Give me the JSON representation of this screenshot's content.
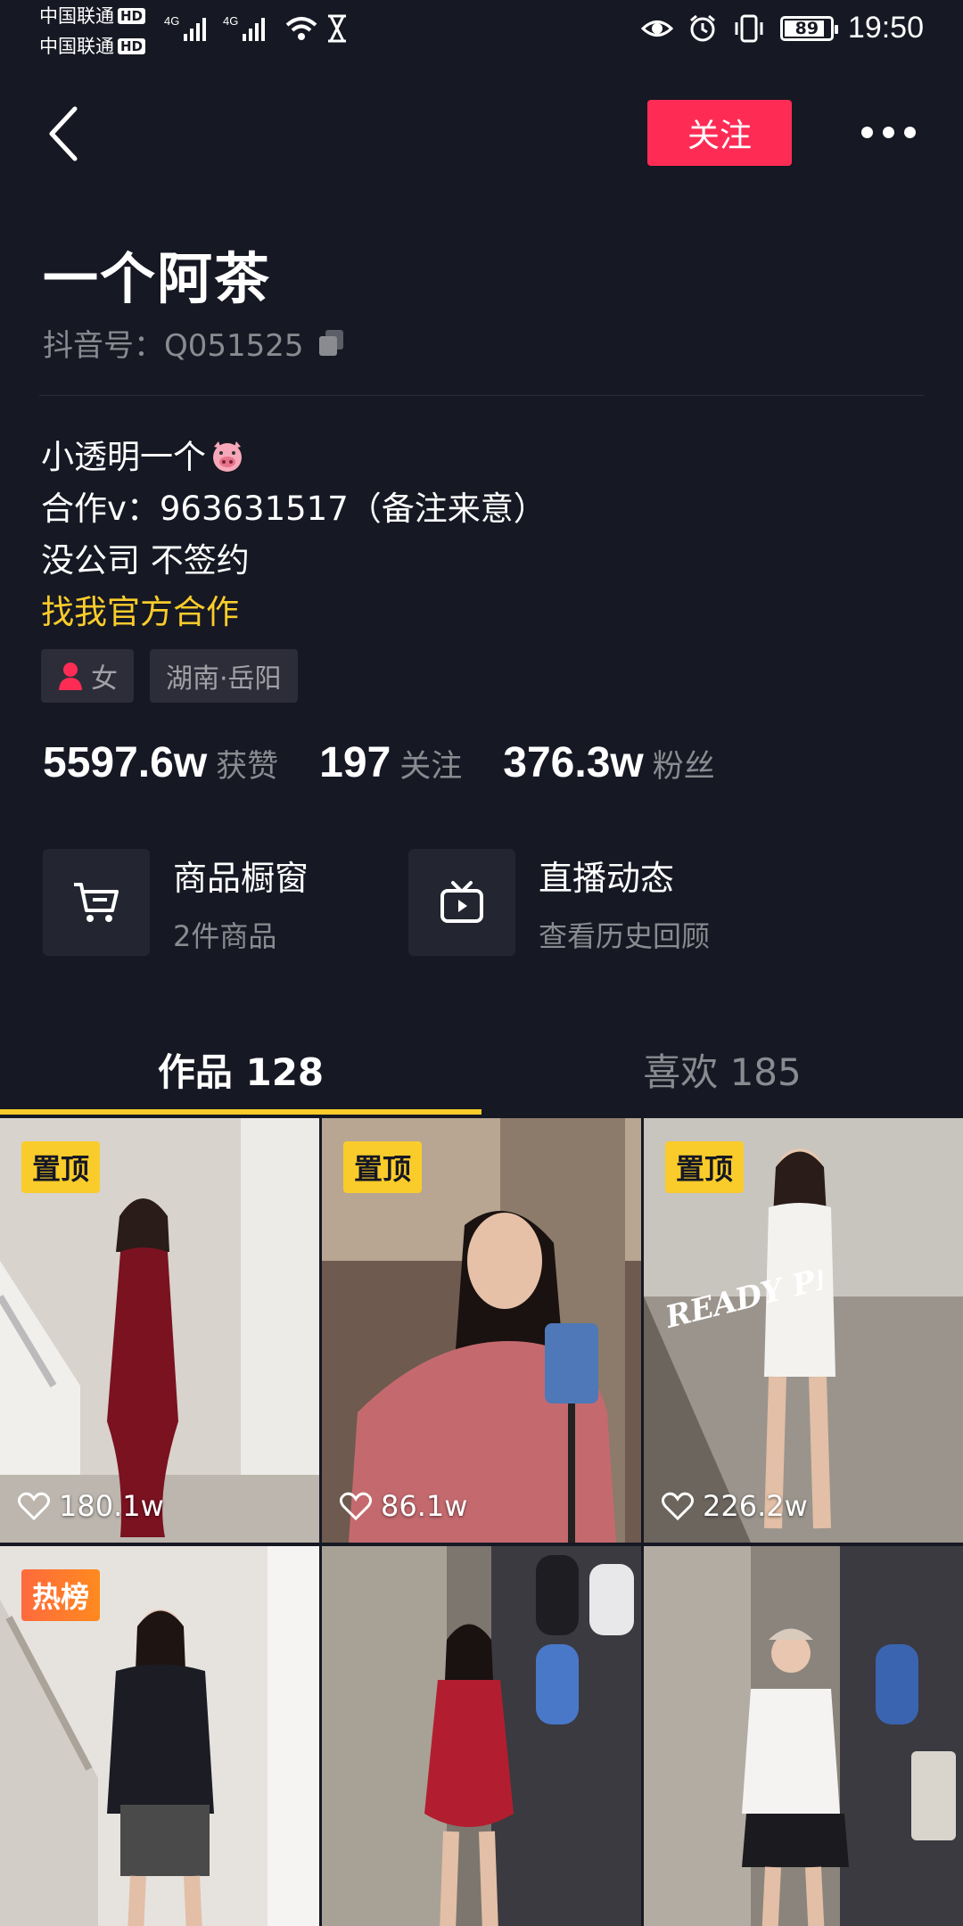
{
  "status_bar": {
    "carrier1": "中国联通",
    "carrier2": "中国联通",
    "hd": "HD",
    "network": "4G",
    "battery": 89,
    "battery_label": "89",
    "time": "19:50"
  },
  "header": {
    "follow_label": "关注"
  },
  "profile": {
    "name": "一个阿茶",
    "douyin_id": "抖音号：Q051525",
    "bio_line1": "小透明一个",
    "bio_line2": "合作v：963631517（备注来意）",
    "bio_line3": "没公司 不签约",
    "bio_link": "找我官方合作",
    "tag_gender": "女",
    "tag_location": "湖南·岳阳"
  },
  "stats": [
    {
      "value": "5597.6w",
      "label": "获赞"
    },
    {
      "value": "197",
      "label": "关注"
    },
    {
      "value": "376.3w",
      "label": "粉丝"
    }
  ],
  "cards": [
    {
      "title": "商品橱窗",
      "sub": "2件商品",
      "icon": "cart-icon"
    },
    {
      "title": "直播动态",
      "sub": "查看历史回顾",
      "icon": "tv-play-icon"
    }
  ],
  "tabs": [
    {
      "label": "作品 128"
    },
    {
      "label": "喜欢 185"
    }
  ],
  "videos": [
    {
      "badge": "置顶",
      "likes": "180.1w"
    },
    {
      "badge": "置顶",
      "likes": "86.1w"
    },
    {
      "badge": "置顶",
      "likes": "226.2w",
      "overlay_text": "READY PERFECTLY"
    },
    {
      "badge": "热榜",
      "likes": ""
    },
    {
      "badge": "",
      "likes": ""
    },
    {
      "badge": "",
      "likes": ""
    }
  ],
  "colors": {
    "background": "#161823",
    "accent_red": "#fe2c55",
    "accent_yellow": "#facc2b"
  }
}
